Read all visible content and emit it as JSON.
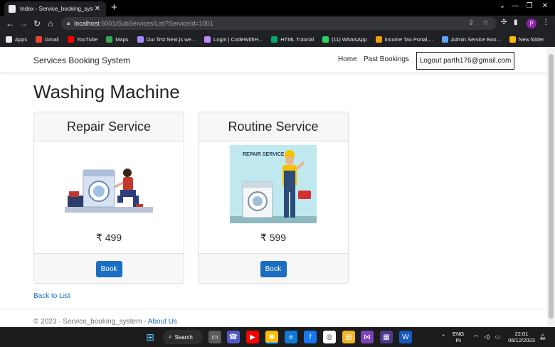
{
  "browser": {
    "tab_title": "Index - Service_booking_system",
    "url_host": "localhost",
    "url_path": ":5001/SubServices/List?ServiceId=1001",
    "profile_initial": "P",
    "bookmarks": [
      {
        "label": "Apps",
        "icon": "apps-grid-icon",
        "color": "#e8eaed"
      },
      {
        "label": "Gmail",
        "icon": "gmail-icon",
        "color": "#ea4335"
      },
      {
        "label": "YouTube",
        "icon": "youtube-icon",
        "color": "#ff0000"
      },
      {
        "label": "Maps",
        "icon": "maps-icon",
        "color": "#34a853"
      },
      {
        "label": "Our first Next.js we...",
        "icon": "site-icon",
        "color": "#a78bfa"
      },
      {
        "label": "Login | CodeWithH...",
        "icon": "site-icon",
        "color": "#c084fc"
      },
      {
        "label": "HTML Tutorial",
        "icon": "w3-icon",
        "color": "#04aa6d"
      },
      {
        "label": "(11) WhatsApp",
        "icon": "whatsapp-icon",
        "color": "#25d366"
      },
      {
        "label": "Income Tax Portal,...",
        "icon": "site-icon",
        "color": "#f59e0b"
      },
      {
        "label": "Admin Service Boo...",
        "icon": "site-icon",
        "color": "#60a5fa"
      },
      {
        "label": "New folder",
        "icon": "folder-icon",
        "color": "#fbbc04"
      }
    ]
  },
  "navbar": {
    "brand": "Services Booking System",
    "home": "Home",
    "past_bookings": "Past Bookings",
    "logout": "Logout parth176@gmail.com"
  },
  "main": {
    "title": "Washing Machine",
    "cards": [
      {
        "title": "Repair Service",
        "price": "₹ 499",
        "button": "Book"
      },
      {
        "title": "Routine Service",
        "price": "₹ 599",
        "button": "Book",
        "image_caption": "REPAIR SERVICE"
      }
    ],
    "back_link": "Back to List"
  },
  "footer": {
    "copyright": "© 2023 - Service_booking_system - ",
    "about": "About Us"
  },
  "taskbar": {
    "search": "Search",
    "lang_top": "ENG",
    "lang_bottom": "IN",
    "time": "22:01",
    "date": "06/12/2023"
  }
}
